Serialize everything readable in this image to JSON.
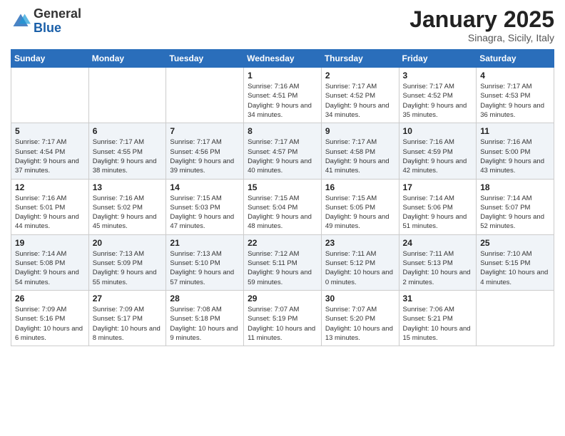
{
  "logo": {
    "general": "General",
    "blue": "Blue"
  },
  "header": {
    "month": "January 2025",
    "location": "Sinagra, Sicily, Italy"
  },
  "weekdays": [
    "Sunday",
    "Monday",
    "Tuesday",
    "Wednesday",
    "Thursday",
    "Friday",
    "Saturday"
  ],
  "weeks": [
    [
      {
        "day": "",
        "sunrise": "",
        "sunset": "",
        "daylight": ""
      },
      {
        "day": "",
        "sunrise": "",
        "sunset": "",
        "daylight": ""
      },
      {
        "day": "",
        "sunrise": "",
        "sunset": "",
        "daylight": ""
      },
      {
        "day": "1",
        "sunrise": "Sunrise: 7:16 AM",
        "sunset": "Sunset: 4:51 PM",
        "daylight": "Daylight: 9 hours and 34 minutes."
      },
      {
        "day": "2",
        "sunrise": "Sunrise: 7:17 AM",
        "sunset": "Sunset: 4:52 PM",
        "daylight": "Daylight: 9 hours and 34 minutes."
      },
      {
        "day": "3",
        "sunrise": "Sunrise: 7:17 AM",
        "sunset": "Sunset: 4:52 PM",
        "daylight": "Daylight: 9 hours and 35 minutes."
      },
      {
        "day": "4",
        "sunrise": "Sunrise: 7:17 AM",
        "sunset": "Sunset: 4:53 PM",
        "daylight": "Daylight: 9 hours and 36 minutes."
      }
    ],
    [
      {
        "day": "5",
        "sunrise": "Sunrise: 7:17 AM",
        "sunset": "Sunset: 4:54 PM",
        "daylight": "Daylight: 9 hours and 37 minutes."
      },
      {
        "day": "6",
        "sunrise": "Sunrise: 7:17 AM",
        "sunset": "Sunset: 4:55 PM",
        "daylight": "Daylight: 9 hours and 38 minutes."
      },
      {
        "day": "7",
        "sunrise": "Sunrise: 7:17 AM",
        "sunset": "Sunset: 4:56 PM",
        "daylight": "Daylight: 9 hours and 39 minutes."
      },
      {
        "day": "8",
        "sunrise": "Sunrise: 7:17 AM",
        "sunset": "Sunset: 4:57 PM",
        "daylight": "Daylight: 9 hours and 40 minutes."
      },
      {
        "day": "9",
        "sunrise": "Sunrise: 7:17 AM",
        "sunset": "Sunset: 4:58 PM",
        "daylight": "Daylight: 9 hours and 41 minutes."
      },
      {
        "day": "10",
        "sunrise": "Sunrise: 7:16 AM",
        "sunset": "Sunset: 4:59 PM",
        "daylight": "Daylight: 9 hours and 42 minutes."
      },
      {
        "day": "11",
        "sunrise": "Sunrise: 7:16 AM",
        "sunset": "Sunset: 5:00 PM",
        "daylight": "Daylight: 9 hours and 43 minutes."
      }
    ],
    [
      {
        "day": "12",
        "sunrise": "Sunrise: 7:16 AM",
        "sunset": "Sunset: 5:01 PM",
        "daylight": "Daylight: 9 hours and 44 minutes."
      },
      {
        "day": "13",
        "sunrise": "Sunrise: 7:16 AM",
        "sunset": "Sunset: 5:02 PM",
        "daylight": "Daylight: 9 hours and 45 minutes."
      },
      {
        "day": "14",
        "sunrise": "Sunrise: 7:15 AM",
        "sunset": "Sunset: 5:03 PM",
        "daylight": "Daylight: 9 hours and 47 minutes."
      },
      {
        "day": "15",
        "sunrise": "Sunrise: 7:15 AM",
        "sunset": "Sunset: 5:04 PM",
        "daylight": "Daylight: 9 hours and 48 minutes."
      },
      {
        "day": "16",
        "sunrise": "Sunrise: 7:15 AM",
        "sunset": "Sunset: 5:05 PM",
        "daylight": "Daylight: 9 hours and 49 minutes."
      },
      {
        "day": "17",
        "sunrise": "Sunrise: 7:14 AM",
        "sunset": "Sunset: 5:06 PM",
        "daylight": "Daylight: 9 hours and 51 minutes."
      },
      {
        "day": "18",
        "sunrise": "Sunrise: 7:14 AM",
        "sunset": "Sunset: 5:07 PM",
        "daylight": "Daylight: 9 hours and 52 minutes."
      }
    ],
    [
      {
        "day": "19",
        "sunrise": "Sunrise: 7:14 AM",
        "sunset": "Sunset: 5:08 PM",
        "daylight": "Daylight: 9 hours and 54 minutes."
      },
      {
        "day": "20",
        "sunrise": "Sunrise: 7:13 AM",
        "sunset": "Sunset: 5:09 PM",
        "daylight": "Daylight: 9 hours and 55 minutes."
      },
      {
        "day": "21",
        "sunrise": "Sunrise: 7:13 AM",
        "sunset": "Sunset: 5:10 PM",
        "daylight": "Daylight: 9 hours and 57 minutes."
      },
      {
        "day": "22",
        "sunrise": "Sunrise: 7:12 AM",
        "sunset": "Sunset: 5:11 PM",
        "daylight": "Daylight: 9 hours and 59 minutes."
      },
      {
        "day": "23",
        "sunrise": "Sunrise: 7:11 AM",
        "sunset": "Sunset: 5:12 PM",
        "daylight": "Daylight: 10 hours and 0 minutes."
      },
      {
        "day": "24",
        "sunrise": "Sunrise: 7:11 AM",
        "sunset": "Sunset: 5:13 PM",
        "daylight": "Daylight: 10 hours and 2 minutes."
      },
      {
        "day": "25",
        "sunrise": "Sunrise: 7:10 AM",
        "sunset": "Sunset: 5:15 PM",
        "daylight": "Daylight: 10 hours and 4 minutes."
      }
    ],
    [
      {
        "day": "26",
        "sunrise": "Sunrise: 7:09 AM",
        "sunset": "Sunset: 5:16 PM",
        "daylight": "Daylight: 10 hours and 6 minutes."
      },
      {
        "day": "27",
        "sunrise": "Sunrise: 7:09 AM",
        "sunset": "Sunset: 5:17 PM",
        "daylight": "Daylight: 10 hours and 8 minutes."
      },
      {
        "day": "28",
        "sunrise": "Sunrise: 7:08 AM",
        "sunset": "Sunset: 5:18 PM",
        "daylight": "Daylight: 10 hours and 9 minutes."
      },
      {
        "day": "29",
        "sunrise": "Sunrise: 7:07 AM",
        "sunset": "Sunset: 5:19 PM",
        "daylight": "Daylight: 10 hours and 11 minutes."
      },
      {
        "day": "30",
        "sunrise": "Sunrise: 7:07 AM",
        "sunset": "Sunset: 5:20 PM",
        "daylight": "Daylight: 10 hours and 13 minutes."
      },
      {
        "day": "31",
        "sunrise": "Sunrise: 7:06 AM",
        "sunset": "Sunset: 5:21 PM",
        "daylight": "Daylight: 10 hours and 15 minutes."
      },
      {
        "day": "",
        "sunrise": "",
        "sunset": "",
        "daylight": ""
      }
    ]
  ]
}
